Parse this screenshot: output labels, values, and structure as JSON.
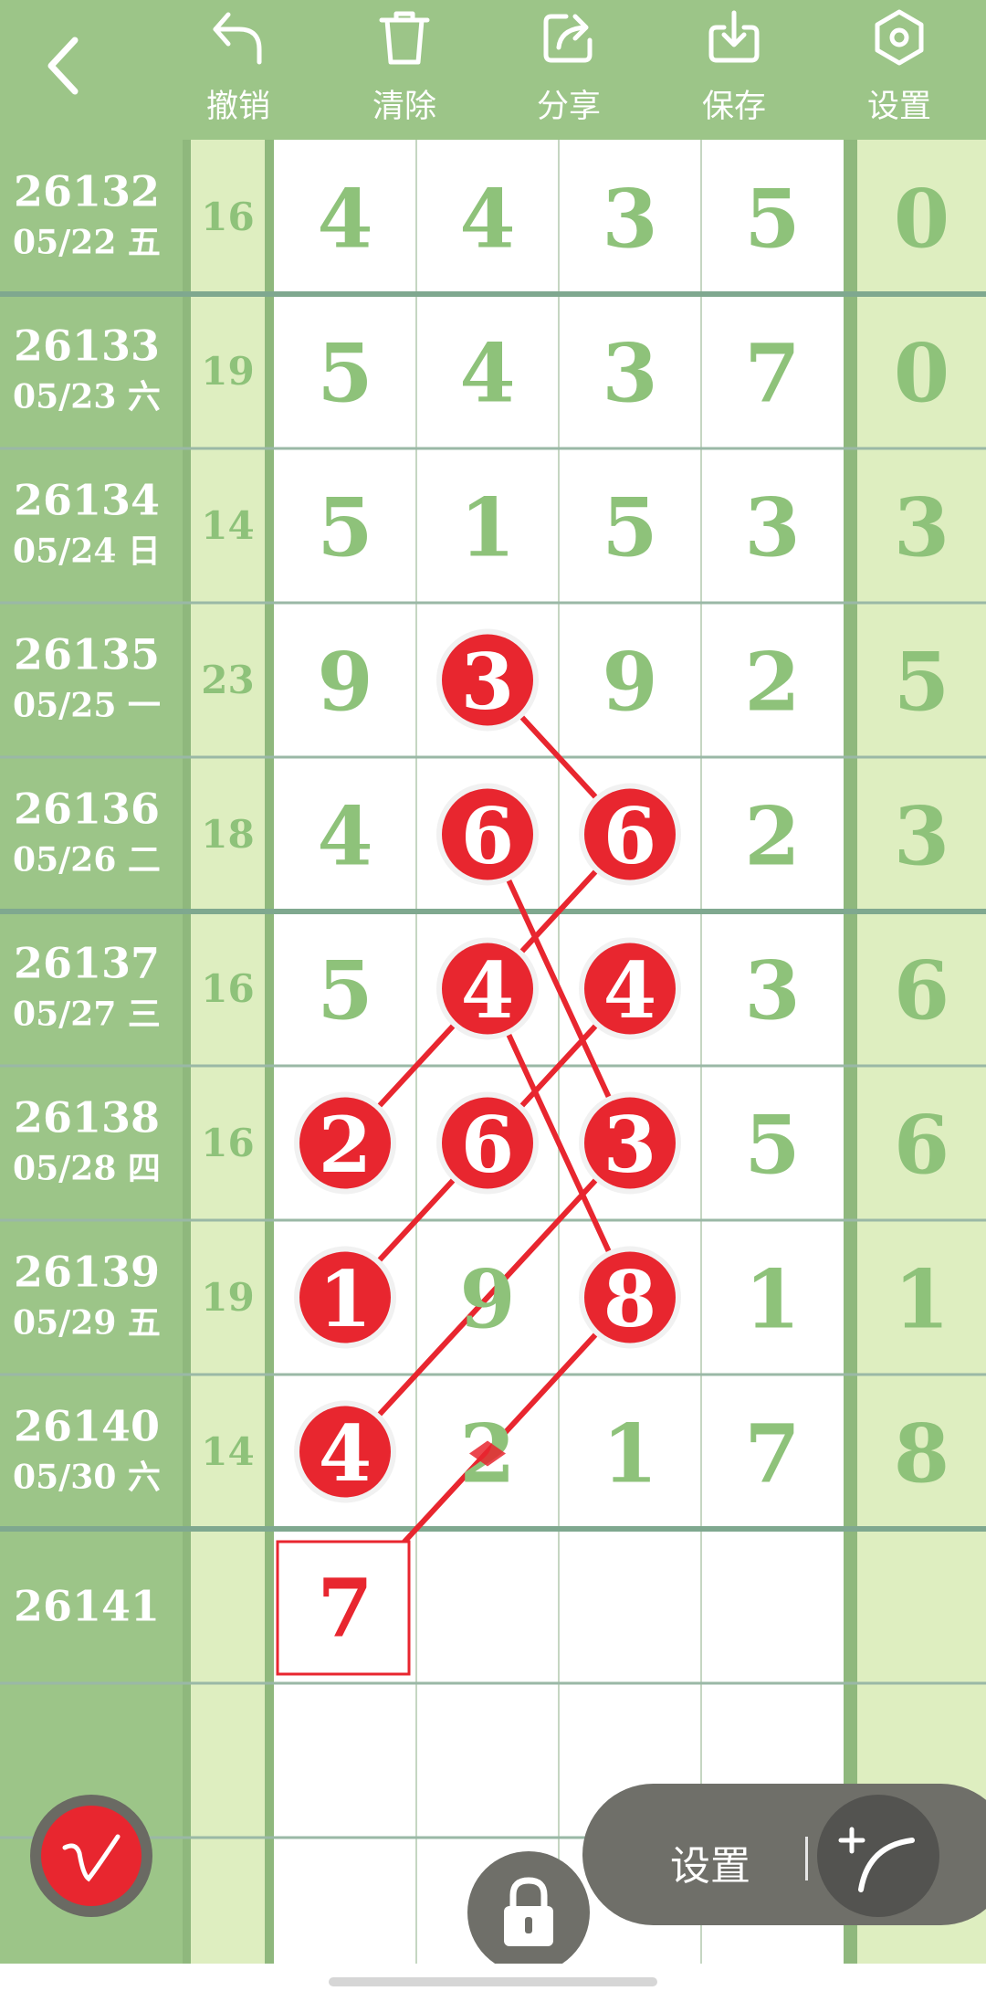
{
  "toolbar": {
    "undo_label": "撤销",
    "clear_label": "清除",
    "share_label": "分享",
    "save_label": "保存",
    "settings_label": "设置"
  },
  "rows": [
    {
      "id": "26132",
      "date": "05/22 五",
      "sum": "16",
      "digits": [
        "4",
        "4",
        "3",
        "5"
      ],
      "last": "0"
    },
    {
      "id": "26133",
      "date": "05/23 六",
      "sum": "19",
      "digits": [
        "5",
        "4",
        "3",
        "7"
      ],
      "last": "0"
    },
    {
      "id": "26134",
      "date": "05/24 日",
      "sum": "14",
      "digits": [
        "5",
        "1",
        "5",
        "3"
      ],
      "last": "3"
    },
    {
      "id": "26135",
      "date": "05/25 一",
      "sum": "23",
      "digits": [
        "9",
        "3",
        "9",
        "2"
      ],
      "last": "5"
    },
    {
      "id": "26136",
      "date": "05/26 二",
      "sum": "18",
      "digits": [
        "4",
        "6",
        "6",
        "2"
      ],
      "last": "3"
    },
    {
      "id": "26137",
      "date": "05/27 三",
      "sum": "16",
      "digits": [
        "5",
        "4",
        "4",
        "3"
      ],
      "last": "6"
    },
    {
      "id": "26138",
      "date": "05/28 四",
      "sum": "16",
      "digits": [
        "2",
        "6",
        "3",
        "5"
      ],
      "last": "6"
    },
    {
      "id": "26139",
      "date": "05/29 五",
      "sum": "19",
      "digits": [
        "1",
        "9",
        "8",
        "1"
      ],
      "last": "1"
    },
    {
      "id": "26140",
      "date": "05/30 六",
      "sum": "14",
      "digits": [
        "4",
        "2",
        "1",
        "7"
      ],
      "last": "8"
    },
    {
      "id": "26141",
      "date": "",
      "sum": "",
      "digits": [
        "7",
        "",
        "",
        ""
      ],
      "last": ""
    }
  ],
  "marks": [
    {
      "row": 3,
      "col": 1
    },
    {
      "row": 4,
      "col": 1
    },
    {
      "row": 4,
      "col": 2
    },
    {
      "row": 5,
      "col": 1
    },
    {
      "row": 5,
      "col": 2
    },
    {
      "row": 6,
      "col": 0
    },
    {
      "row": 6,
      "col": 1
    },
    {
      "row": 6,
      "col": 2
    },
    {
      "row": 7,
      "col": 0
    },
    {
      "row": 7,
      "col": 2
    },
    {
      "row": 8,
      "col": 0
    }
  ],
  "lines": [
    [
      {
        "row": 3,
        "col": 1
      },
      {
        "row": 4,
        "col": 2
      }
    ],
    [
      {
        "row": 4,
        "col": 2
      },
      {
        "row": 6,
        "col": 0
      }
    ],
    [
      {
        "row": 4,
        "col": 1
      },
      {
        "row": 6,
        "col": 2
      }
    ],
    [
      {
        "row": 5,
        "col": 2
      },
      {
        "row": 7,
        "col": 0
      }
    ],
    [
      {
        "row": 5,
        "col": 1
      },
      {
        "row": 7,
        "col": 2
      }
    ],
    [
      {
        "row": 6,
        "col": 2
      },
      {
        "row": 8,
        "col": 0
      }
    ],
    [
      {
        "row": 7,
        "col": 2
      },
      {
        "row": 9,
        "col": 0
      }
    ]
  ],
  "boxed": {
    "row": 9,
    "col": 0
  },
  "bottom": {
    "settings_label": "设置"
  },
  "colors": {
    "green": "#9cc588",
    "light_green": "#deeec0",
    "digit_green": "#8ec27a",
    "red": "#e8262f"
  }
}
